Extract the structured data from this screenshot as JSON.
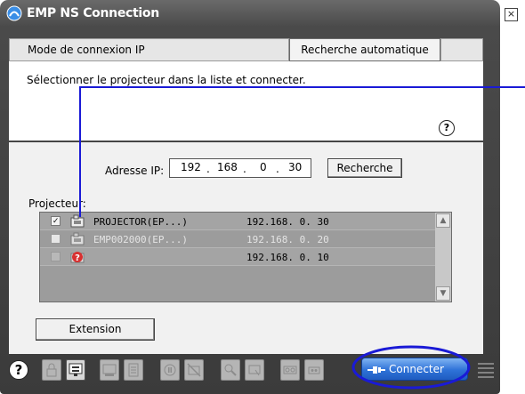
{
  "window": {
    "title": "EMP NS Connection",
    "close_glyph": "×"
  },
  "tabs": {
    "mode_label": "Mode de connexion IP",
    "auto_search_label": "Recherche automatique"
  },
  "instruction": "Sélectionner le projecteur dans la liste et connecter.",
  "help_glyph": "?",
  "ip": {
    "label": "Adresse IP:",
    "octets": [
      "192",
      "168",
      "0",
      "30"
    ],
    "search_button": "Recherche"
  },
  "projectors": {
    "label": "Projecteur:",
    "rows": [
      {
        "checked": true,
        "check_glyph": "✓",
        "name": "PROJECTOR(EP...)",
        "ip": "192.168.  0. 30",
        "enabled": true,
        "icon": "projector-icon"
      },
      {
        "checked": false,
        "check_glyph": "",
        "name": "EMP002000(EP...)",
        "ip": "192.168.  0. 20",
        "enabled": false,
        "icon": "projector-icon"
      },
      {
        "checked": false,
        "check_glyph": "",
        "name": "",
        "ip": "192.168.  0. 10",
        "enabled": false,
        "icon": "error-icon"
      }
    ]
  },
  "extension_button": "Extension",
  "connect_button": "Connecter",
  "colors": {
    "frame": "#4a4a4a",
    "connect_blue": "#2e72d8",
    "annotation_blue": "#1a1ad6",
    "disabled_text": "#e4e4e4",
    "error_red": "#d83030"
  }
}
